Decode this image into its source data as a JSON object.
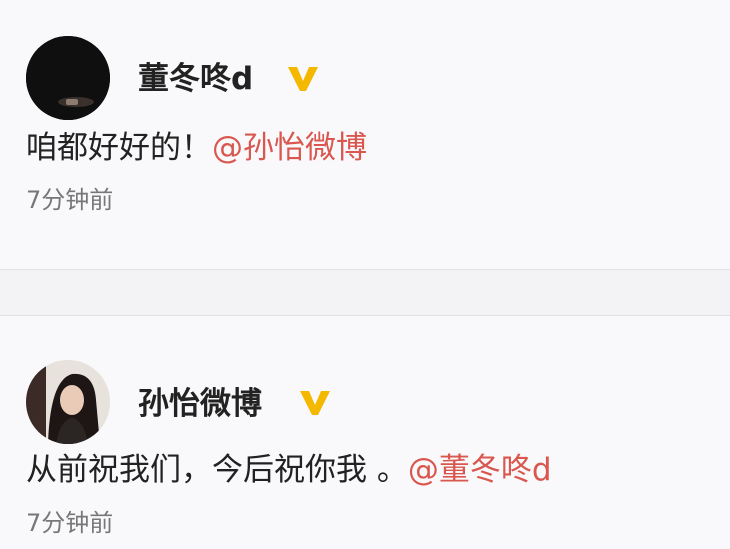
{
  "posts": [
    {
      "username": "董冬咚d",
      "verified_icon": "verified-badge-icon",
      "text": "咱都好好的！",
      "mention": "@孙怡微博",
      "time": "7分钟前"
    },
    {
      "username": "孙怡微博",
      "verified_icon": "verified-badge-icon",
      "text": "从前祝我们，今后祝你我 。",
      "mention": "@董冬咚d",
      "time": "7分钟前"
    }
  ],
  "colors": {
    "background": "#f9f9fb",
    "mention": "#d9574e",
    "verified": "#f5b800",
    "username": "#222222",
    "time": "#777777"
  }
}
